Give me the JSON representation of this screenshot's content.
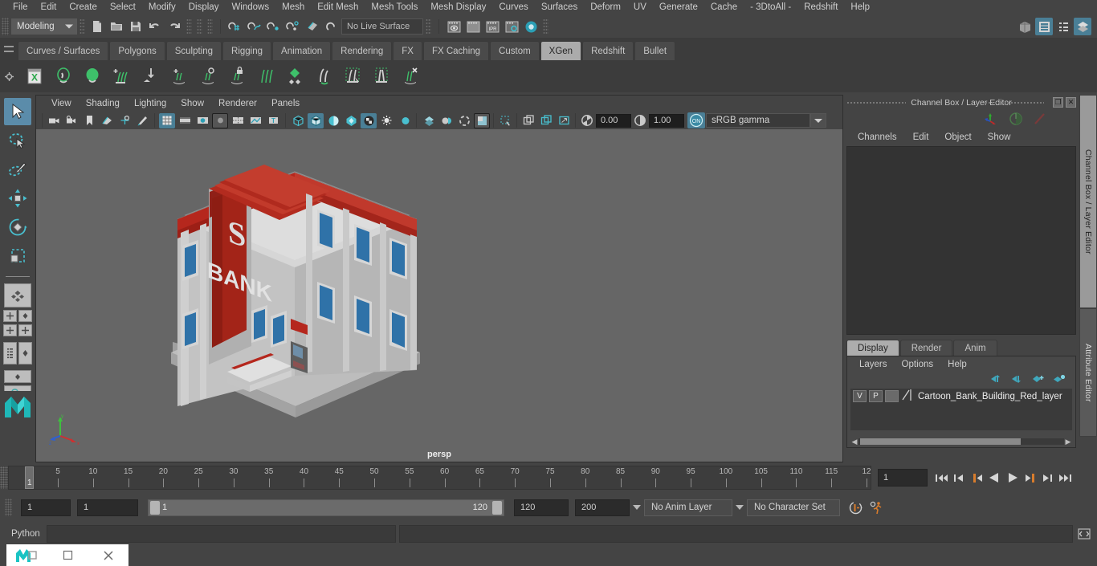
{
  "menubar": {
    "items": [
      "File",
      "Edit",
      "Create",
      "Select",
      "Modify",
      "Display",
      "Windows",
      "Mesh",
      "Edit Mesh",
      "Mesh Tools",
      "Mesh Display",
      "Curves",
      "Surfaces",
      "Deform",
      "UV",
      "Generate",
      "Cache",
      "- 3DtoAll -",
      "Redshift",
      "Help"
    ]
  },
  "statusline": {
    "mode": "Modeling",
    "live_surface": "No Live Surface",
    "icons": {
      "new": "new-scene-icon",
      "open": "open-scene-icon",
      "save": "save-scene-icon",
      "undo": "undo-icon",
      "redo": "redo-icon",
      "snap_grid": "snap-to-grid-icon",
      "snap_curve": "snap-to-curve-icon",
      "snap_point": "snap-to-point-icon",
      "snap_projected": "snap-to-projected-center-icon",
      "snap_view": "snap-to-view-plane-icon",
      "make_live": "make-live-icon",
      "render_current": "render-current-frame-icon",
      "render_seq": "render-sequence-icon",
      "ipr": "ipr-render-icon",
      "render_settings": "render-settings-icon",
      "hypershade": "hypershade-icon",
      "outliner": "outliner-icon",
      "node_editor": "node-editor-icon",
      "attr_list": "attribute-list-icon",
      "layer_stack": "layer-editor-icon"
    },
    "ipr_label": "IPR"
  },
  "shelf": {
    "tabs": [
      "Curves / Surfaces",
      "Polygons",
      "Sculpting",
      "Rigging",
      "Animation",
      "Rendering",
      "FX",
      "FX Caching",
      "Custom",
      "XGen",
      "Redshift",
      "Bullet"
    ],
    "active_tab": "XGen",
    "buttons": [
      "xgen-editor-icon",
      "xgen-preview-icon",
      "xgen-sphere-icon",
      "xgen-add-guides-icon",
      "xgen-move-guides-icon",
      "xgen-add-region-icon",
      "xgen-circle-guide-icon",
      "xgen-lock-guide-icon",
      "xgen-comb-icon",
      "xgen-density-icon",
      "xgen-sculpt-guide-icon",
      "xgen-select-guide-icon",
      "xgen-clump-icon",
      "xgen-delete-guide-icon"
    ]
  },
  "toolbox": {
    "tools": [
      {
        "name": "select-tool",
        "selected": true
      },
      {
        "name": "lasso-select-tool",
        "selected": false
      },
      {
        "name": "paint-select-tool",
        "selected": false
      },
      {
        "name": "move-tool",
        "selected": false
      },
      {
        "name": "rotate-tool",
        "selected": false
      },
      {
        "name": "scale-tool",
        "selected": false
      }
    ],
    "layouts": [
      "single-pane-layout",
      "four-pane-layout",
      "outliner-persp-layout",
      "persp-graph-layout",
      "maya-logo-icon"
    ]
  },
  "viewport": {
    "menus": [
      "View",
      "Shading",
      "Lighting",
      "Show",
      "Renderer",
      "Panels"
    ],
    "toolbar_icons": [
      "select-camera-icon",
      "camera-attributes-icon",
      "bookmark-icon",
      "image-plane-icon",
      "two-d-pan-zoom-icon",
      "grease-pencil-icon",
      "grid-toggle-icon",
      "film-gate-icon",
      "resolution-gate-icon",
      "gate-mask-icon",
      "film-origin-icon",
      "exposure-icon",
      "texture-icon",
      "wireframe-icon",
      "smooth-shade-icon",
      "shaded-wireframe-icon",
      "hardware-texture-icon",
      "use-default-material-icon",
      "lights-icon",
      "shadows-icon",
      "ao-icon",
      "motion-blur-icon",
      "multisample-icon",
      "isolate-select-icon",
      "xray-icon",
      "xray-joints-icon",
      "xray-active-icon"
    ],
    "exposure_value": "0.00",
    "gamma_value": "1.00",
    "color_profile": "sRGB gamma",
    "camera_label": "persp",
    "axis_labels": {
      "x": "x",
      "y": "y",
      "z": "z"
    },
    "scene_object": "Cartoon Bank Building"
  },
  "channelbox": {
    "title": "Channel Box / Layer Editor",
    "menus": [
      "Channels",
      "Edit",
      "Object",
      "Show"
    ],
    "icons": [
      "channel-box-icon",
      "attribute-editor-icon",
      "tool-settings-icon"
    ],
    "restore_glyph": "❐",
    "close_glyph": "✕"
  },
  "layer_editor": {
    "tabs": [
      "Display",
      "Render",
      "Anim"
    ],
    "active_tab": "Display",
    "menus": [
      "Layers",
      "Options",
      "Help"
    ],
    "buttons": [
      "move-layer-up-icon",
      "move-layer-down-icon",
      "create-empty-layer-icon",
      "create-layer-from-selected-icon"
    ],
    "layers": [
      {
        "visibility": "V",
        "playback": "P",
        "shading": "",
        "name": "Cartoon_Bank_Building_Red_layer"
      }
    ]
  },
  "vertical_tabs": [
    {
      "label": "Channel Box / Layer Editor",
      "active": true
    },
    {
      "label": "Attribute Editor",
      "active": false
    }
  ],
  "timeline": {
    "start": 1,
    "end": 120,
    "current_frame": "1",
    "tick_labels": [
      "5",
      "10",
      "15",
      "20",
      "25",
      "30",
      "35",
      "40",
      "45",
      "50",
      "55",
      "60",
      "65",
      "70",
      "75",
      "80",
      "85",
      "90",
      "95",
      "100",
      "105",
      "110",
      "115",
      "12"
    ],
    "playback_buttons": [
      "go-to-start-icon",
      "step-back-keyframe-icon",
      "step-back-frame-icon",
      "play-backwards-icon",
      "play-forwards-icon",
      "step-forward-frame-icon",
      "step-forward-keyframe-icon",
      "go-to-end-icon"
    ]
  },
  "range_slider": {
    "anim_start": "1",
    "playback_start": "1",
    "range_min_label": "1",
    "range_max_label": "120",
    "playback_end": "120",
    "anim_end": "200",
    "anim_layer": "No Anim Layer",
    "character_set": "No Character Set",
    "auto_key_icon": "auto-keyframe-icon",
    "anim_prefs_icon": "animation-preferences-icon"
  },
  "command_line": {
    "language": "Python",
    "input_value": "",
    "result_value": "",
    "script_editor_icon": "script-editor-icon"
  },
  "taskbar": {
    "app_icon": "maya-app-icon",
    "restore_glyph": "❐",
    "minimize_glyph": "▭",
    "close_glyph": "✕"
  },
  "colors": {
    "bg": "#444444",
    "panel": "#3c3c3c",
    "viewport_bg": "#666666",
    "accent_teal": "#4a9fbf",
    "accent_orange": "#d1762c",
    "selected_tab": "#adadad",
    "building_red": "#b5271d",
    "building_grey": "#c8c8c8",
    "window_blue": "#2f72a8"
  }
}
